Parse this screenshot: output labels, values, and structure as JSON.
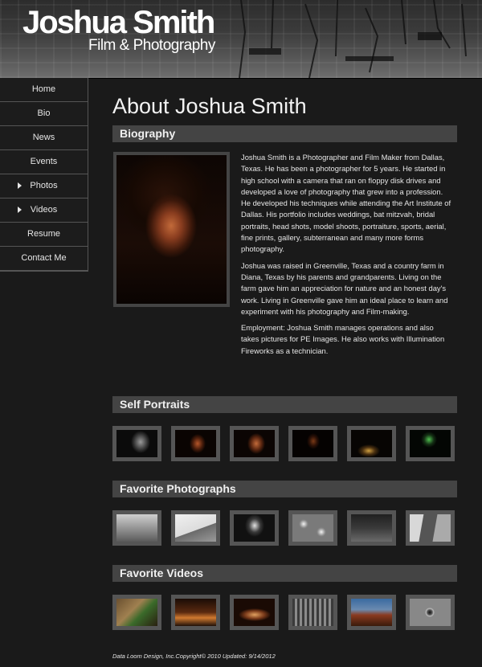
{
  "header": {
    "title": "Joshua Smith",
    "subtitle": "Film & Photography"
  },
  "nav": {
    "items": [
      {
        "label": "Home",
        "submenu": false
      },
      {
        "label": "Bio",
        "submenu": false
      },
      {
        "label": "News",
        "submenu": false
      },
      {
        "label": "Events",
        "submenu": false
      },
      {
        "label": "Photos",
        "submenu": true
      },
      {
        "label": "Videos",
        "submenu": true
      },
      {
        "label": "Resume",
        "submenu": false
      },
      {
        "label": "Contact Me",
        "submenu": false
      }
    ]
  },
  "main": {
    "page_title": "About Joshua Smith",
    "biography": {
      "heading": "Biography",
      "paragraphs": [
        "Joshua Smith is a Photographer and Film Maker from Dallas, Texas. He has been a photographer for 5 years. He started in high school with a camera that ran on floppy disk drives and developed a love of photography that grew into a profession. He developed his techniques while attending the Art Institute of Dallas. His portfolio includes weddings, bat mitzvah, bridal portraits, head shots, model shoots, portraiture, sports, aerial, fine prints, gallery, subterranean and many more forms photography.",
        "Joshua was raised in Greenville, Texas and a country farm in Diana, Texas by his parents and grandparents. Living on the farm gave him an appreciation for nature and an honest day's work. Living in Greenville gave him an ideal place to learn and experiment with his photography and Film-making.",
        "Employment: Joshua Smith manages operations and also takes pictures for PE Images. He also works with Illumination Fireworks as a technician."
      ]
    },
    "self_portraits": {
      "heading": "Self Portraits"
    },
    "favorite_photographs": {
      "heading": "Favorite Photographs"
    },
    "favorite_videos": {
      "heading": "Favorite Videos"
    }
  },
  "footer": {
    "text": "Data Loom Design, Inc.Copyright© 2010 Updated: 9/14/2012"
  }
}
